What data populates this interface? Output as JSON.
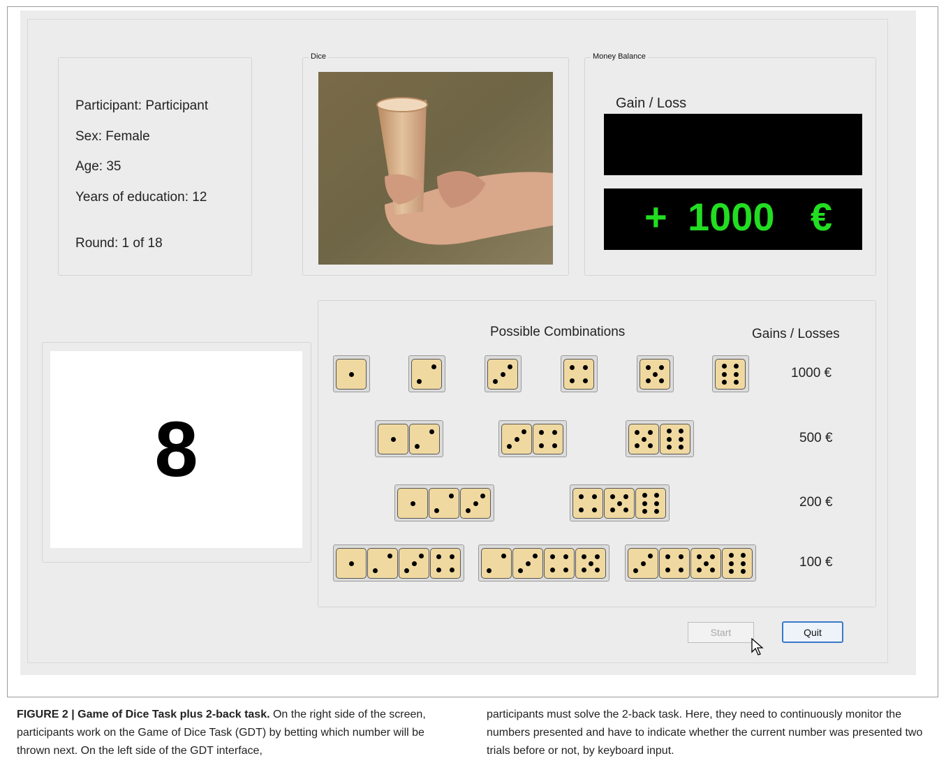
{
  "participant": {
    "name_line": "Participant: Participant",
    "sex_line": "Sex: Female",
    "age_line": "Age: 35",
    "education_line": "Years of education: 12",
    "round_line": "Round: 1 of 18"
  },
  "dice_panel": {
    "legend": "Dice"
  },
  "money_panel": {
    "legend": "Money Balance",
    "gain_loss_label": "Gain / Loss",
    "gain_loss_value": "",
    "balance_sign": "+",
    "balance_value": "1000",
    "balance_currency": "€",
    "balance_color": "#22dd22"
  },
  "nback": {
    "current_number": "8"
  },
  "combinations": {
    "title": "Possible Combinations",
    "gains_header": "Gains / Losses",
    "rows": [
      {
        "amount": "1000 €",
        "groups": [
          [
            1
          ],
          [
            2
          ],
          [
            3
          ],
          [
            4
          ],
          [
            5
          ],
          [
            6
          ]
        ]
      },
      {
        "amount": "500 €",
        "groups": [
          [
            1,
            2
          ],
          [
            3,
            4
          ],
          [
            5,
            6
          ]
        ]
      },
      {
        "amount": "200 €",
        "groups": [
          [
            1,
            2,
            3
          ],
          [
            4,
            5,
            6
          ]
        ]
      },
      {
        "amount": "100 €",
        "groups": [
          [
            1,
            2,
            3,
            4
          ],
          [
            2,
            3,
            4,
            5
          ],
          [
            3,
            4,
            5,
            6
          ]
        ]
      }
    ]
  },
  "buttons": {
    "start": "Start",
    "quit": "Quit"
  },
  "caption": {
    "label": "FIGURE 2 | Game of Dice Task plus 2-back task.",
    "col1": "On the right side of the screen, participants work on the Game of Dice Task (GDT) by betting which number will be thrown next. On the left side of the GDT interface,",
    "col2": "participants must solve the 2-back task. Here, they need to continuously monitor the numbers presented and have to indicate whether the current number was presented two trials before or not, by keyboard input."
  }
}
